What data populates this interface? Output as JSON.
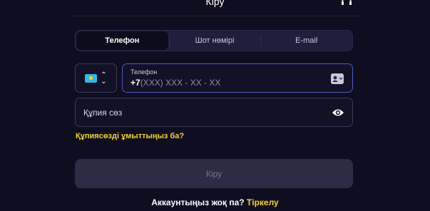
{
  "header": {
    "title": "Кіру"
  },
  "tabs": [
    {
      "label": "Телефон",
      "active": true
    },
    {
      "label": "Шот нөмірі",
      "active": false
    },
    {
      "label": "E-mail",
      "active": false
    }
  ],
  "country_select": {
    "flag": "kazakhstan-flag-icon",
    "arrows": "⌃⌄"
  },
  "phone_field": {
    "label": "Телефон",
    "prefix": "+7",
    "mask": "(XXX) XXX - XX - XX"
  },
  "password_field": {
    "placeholder": "Құпия сөз"
  },
  "forgot_link": "Құпиясөзді ұмыттыңыз ба?",
  "login_button": "Кіру",
  "signup": {
    "question": "Аккаунтыңыз жоқ па?",
    "link": "Тіркелу"
  },
  "colors": {
    "background": "#0f0e20",
    "accent_yellow": "#f5d33a",
    "focus_border": "#4e5bc0"
  }
}
